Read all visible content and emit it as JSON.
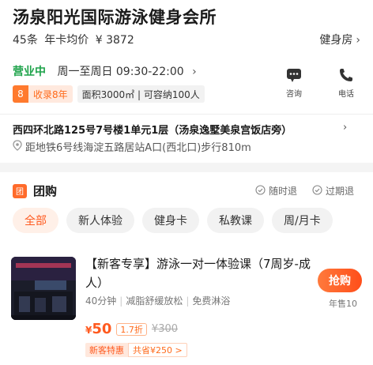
{
  "shop": {
    "name": "汤泉阳光国际游泳健身会所",
    "reviews": "45条",
    "avg_label": "年卡均价",
    "avg_price": "¥ 3872",
    "category": "健身房"
  },
  "hours": {
    "status": "营业中",
    "text": "周一至周日 09:30-22:00"
  },
  "tags": {
    "years_num": "8",
    "years_text": "收录8年",
    "facility": "面积3000㎡ | 可容纳100人"
  },
  "actions": [
    {
      "label": "咨询",
      "icon": "chat-icon"
    },
    {
      "label": "电话",
      "icon": "phone-icon"
    }
  ],
  "address": {
    "line": "西四环北路125号7号楼1单元1层（汤泉逸墅美泉宫饭店旁）",
    "metro": "距地铁6号线海淀五路居站A口(西北口)步行810m"
  },
  "group": {
    "title": "团购",
    "guarantee_1": "随时退",
    "guarantee_2": "过期退"
  },
  "filters": [
    "全部",
    "新人体验",
    "健身卡",
    "私教课",
    "周/月卡"
  ],
  "deal": {
    "title": "【新客专享】游泳一对一体验课（7周岁-成人）",
    "meta_1": "40分钟",
    "meta_2": "减脂舒缓放松",
    "meta_3": "免费淋浴",
    "price_symbol": "¥",
    "price": "50",
    "discount": "1.7折",
    "original": "¥300",
    "promo_a": "新客特惠",
    "promo_b": "共省¥250 >",
    "buy_label": "抢购",
    "sold": "年售10"
  },
  "colors": {
    "accent": "#ff5a1f",
    "open_green": "#1ea34a"
  }
}
